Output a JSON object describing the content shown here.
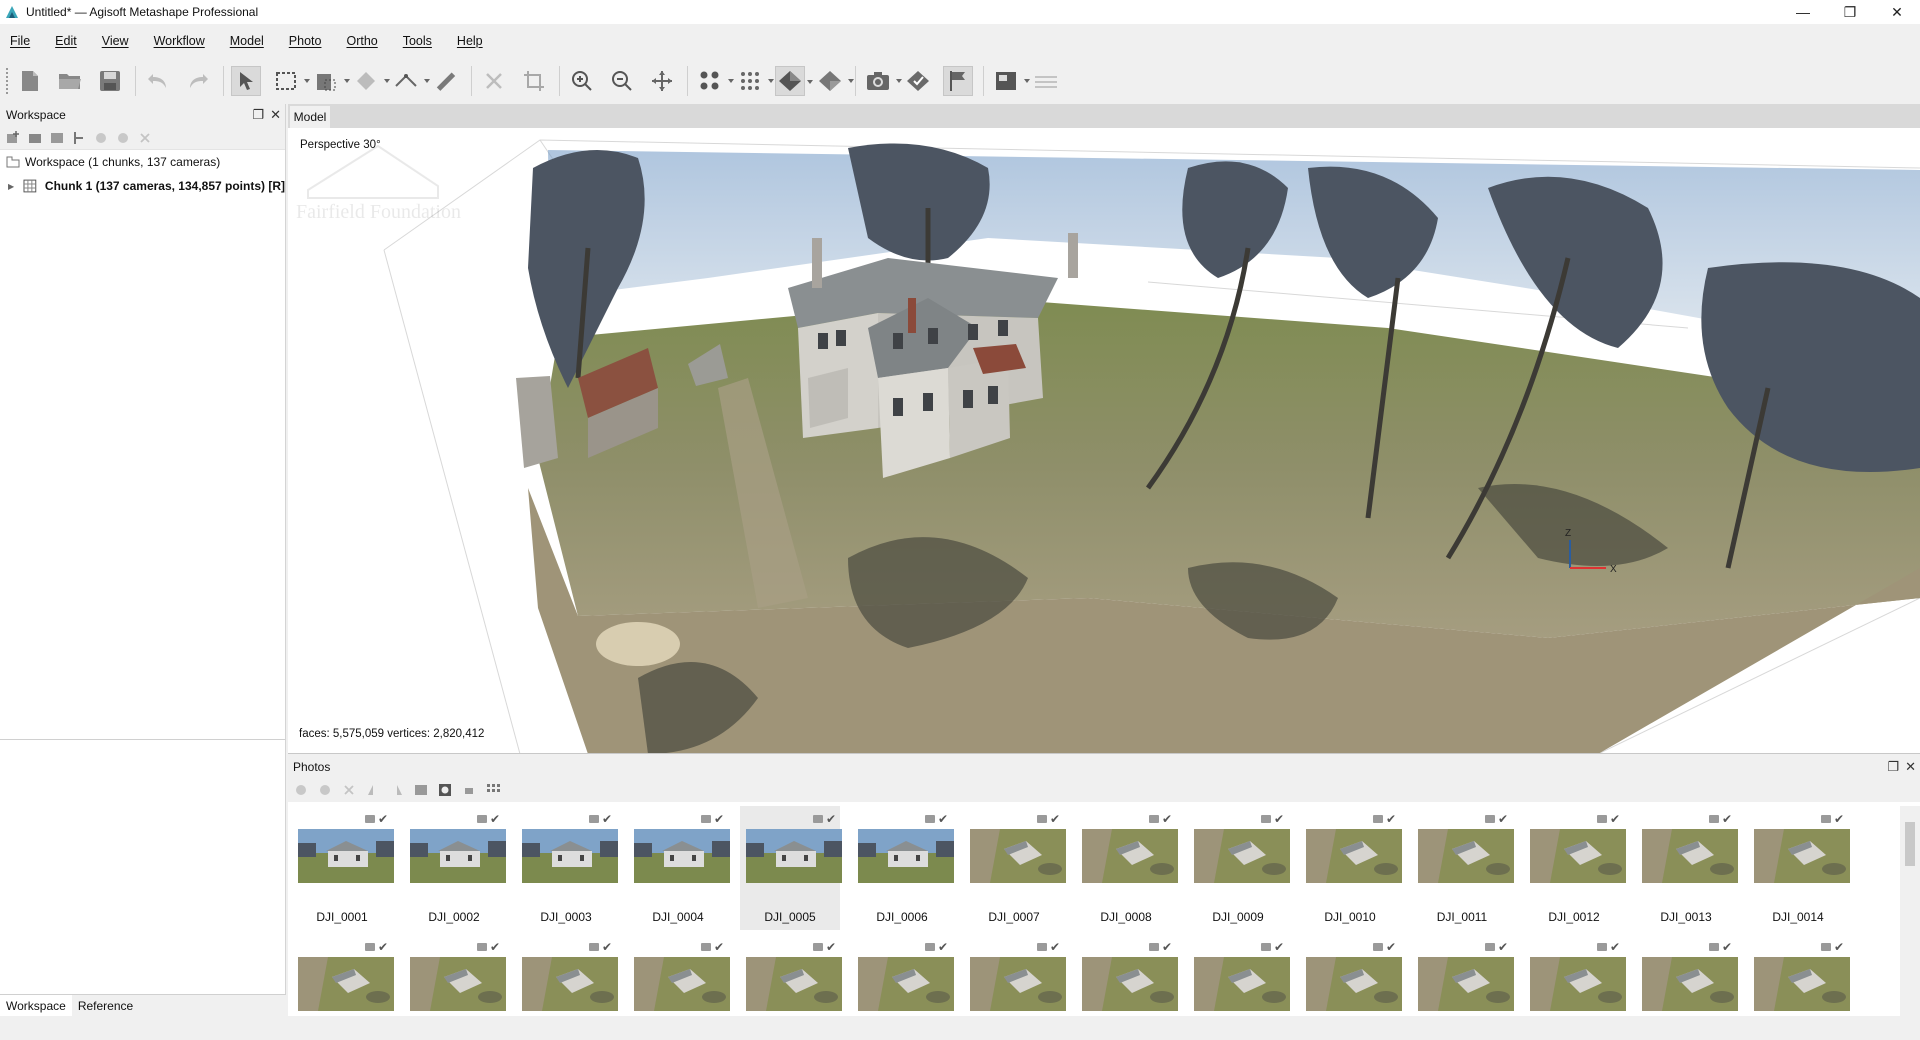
{
  "window": {
    "title": "Untitled* — Agisoft Metashape Professional",
    "minimize": "—",
    "restore": "❐",
    "close": "✕"
  },
  "menu": [
    "File",
    "Edit",
    "View",
    "Workflow",
    "Model",
    "Photo",
    "Ortho",
    "Tools",
    "Help"
  ],
  "toolbar_icons": [
    "new-document-icon",
    "open-folder-icon",
    "save-icon",
    "undo-icon",
    "redo-icon",
    "navigation-pointer-icon",
    "rectangle-selection-icon",
    "model-selection-icon",
    "shape-icon",
    "ruler-icon",
    "measure-icon",
    "delete-selection-icon",
    "crop-selection-icon",
    "zoom-in-icon",
    "zoom-out-icon",
    "reset-view-icon",
    "point-cloud-icon",
    "dense-cloud-icon",
    "shaded-model-icon",
    "textured-model-icon",
    "cameras-icon",
    "markers-icon",
    "flags-icon",
    "ortho-view-icon",
    "grid-icon"
  ],
  "workspace": {
    "title": "Workspace",
    "root": "Workspace (1 chunks, 137 cameras)",
    "chunk": "Chunk 1 (137 cameras, 134,857 points) [R]",
    "tabs": [
      "Workspace",
      "Reference"
    ]
  },
  "model": {
    "tab": "Model",
    "projection": "Perspective 30°",
    "stats": "faces: 5,575,059 vertices: 2,820,412",
    "axis_labels": {
      "x": "X",
      "z": "Z"
    },
    "watermark": "Fairfield Foundation"
  },
  "photos": {
    "title": "Photos",
    "selected": "DJI_0005",
    "row1": [
      "DJI_0001",
      "DJI_0002",
      "DJI_0003",
      "DJI_0004",
      "DJI_0005",
      "DJI_0006",
      "DJI_0007",
      "DJI_0008",
      "DJI_0009",
      "DJI_0010",
      "DJI_0011",
      "DJI_0012",
      "DJI_0013",
      "DJI_0014"
    ],
    "row2_count": 14
  },
  "colors": {
    "accent": "#2a5d9f",
    "grass": "#7c8a4e",
    "sky": "#7fa3c8",
    "house": "#cfcfcf",
    "roof": "#8a8f91"
  }
}
